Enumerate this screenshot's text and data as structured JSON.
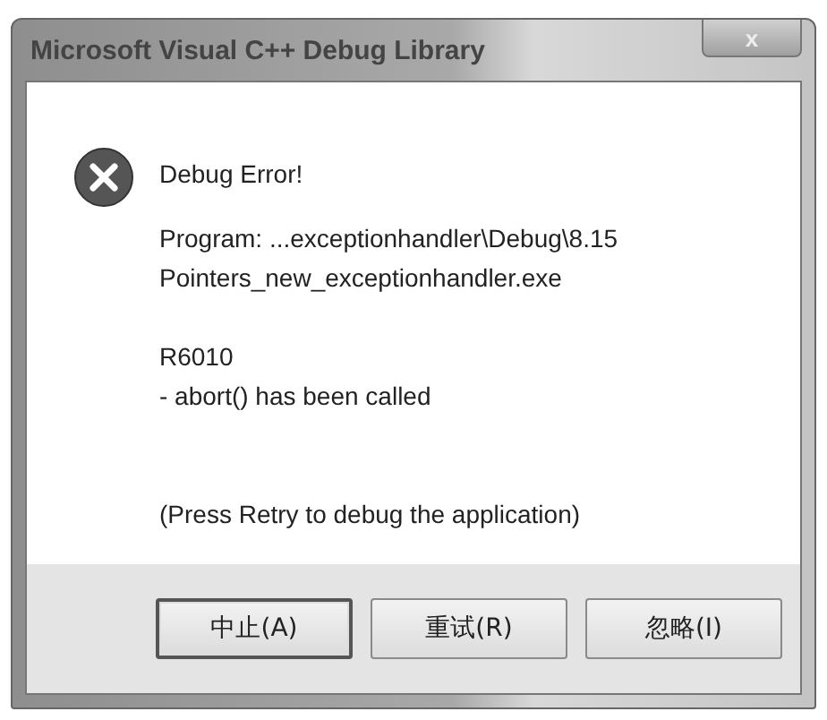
{
  "window": {
    "title": "Microsoft Visual C++ Debug Library",
    "close": "x"
  },
  "message": {
    "heading": "Debug Error!",
    "paragraphs": [
      [
        "Program: ...exceptionhandler\\Debug\\8.15",
        "Pointers_new_exceptionhandler.exe"
      ],
      [
        "R6010",
        "- abort() has been called"
      ],
      [
        "(Press Retry to debug the application)"
      ]
    ]
  },
  "buttons": [
    {
      "label": "中止(A)",
      "default": true
    },
    {
      "label": "重试(R)",
      "default": false
    },
    {
      "label": "忽略(I)",
      "default": false
    }
  ]
}
